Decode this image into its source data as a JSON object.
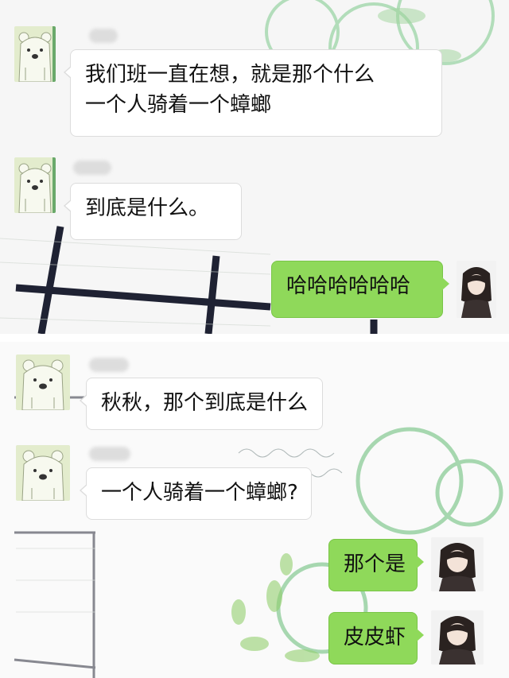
{
  "screenshots": [
    {
      "messages": [
        {
          "sender": "other",
          "avatar": "bear-avatar",
          "lines": [
            "我们班一直在想，就是那个什么",
            "一个人骑着一个蟑螂"
          ]
        },
        {
          "sender": "other",
          "avatar": "bear-avatar",
          "lines": [
            "到底是什么。"
          ]
        },
        {
          "sender": "self",
          "avatar": "girl-avatar",
          "lines": [
            "哈哈哈哈哈哈"
          ]
        }
      ]
    },
    {
      "messages": [
        {
          "sender": "other",
          "avatar": "bear-avatar",
          "lines": [
            "秋秋，那个到底是什么"
          ]
        },
        {
          "sender": "other",
          "avatar": "bear-avatar",
          "lines": [
            "一个人骑着一个蟑螂?"
          ]
        },
        {
          "sender": "self",
          "avatar": "girl-avatar",
          "lines": [
            "那个是"
          ]
        },
        {
          "sender": "self",
          "avatar": "girl-avatar",
          "lines": [
            "皮皮虾"
          ]
        }
      ]
    }
  ],
  "colors": {
    "incoming_bubble": "#ffffff",
    "outgoing_bubble": "#8fd95a",
    "bear_avatar": "#e3eccd"
  }
}
